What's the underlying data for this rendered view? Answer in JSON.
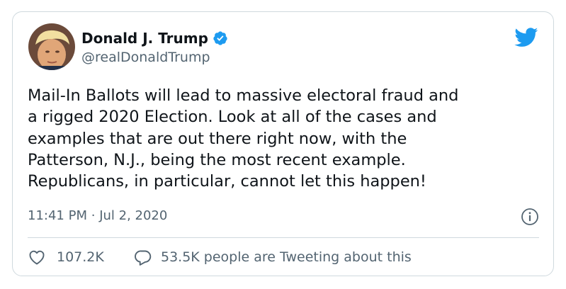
{
  "author": {
    "display_name": "Donald J. Trump",
    "handle": "@realDonaldTrump",
    "verified": true
  },
  "tweet": {
    "text": "Mail-In Ballots will lead to massive electoral fraud and\na rigged 2020 Election. Look at all of the cases and\nexamples that are out there right now, with the\nPatterson, N.J., being the most recent example.\nRepublicans, in particular, cannot let this happen!",
    "time": "11:41 PM",
    "separator": "·",
    "date": "Jul 2, 2020"
  },
  "stats": {
    "likes": "107.2K",
    "conversation": "53.5K people are Tweeting about this"
  },
  "colors": {
    "brand": "#1d9bf0",
    "text": "#0f1419",
    "secondary": "#536471",
    "border": "#cfd9de"
  },
  "icons": [
    "avatar",
    "verified-badge-icon",
    "twitter-bird-icon",
    "info-icon",
    "heart-icon",
    "reply-bubble-icon"
  ]
}
